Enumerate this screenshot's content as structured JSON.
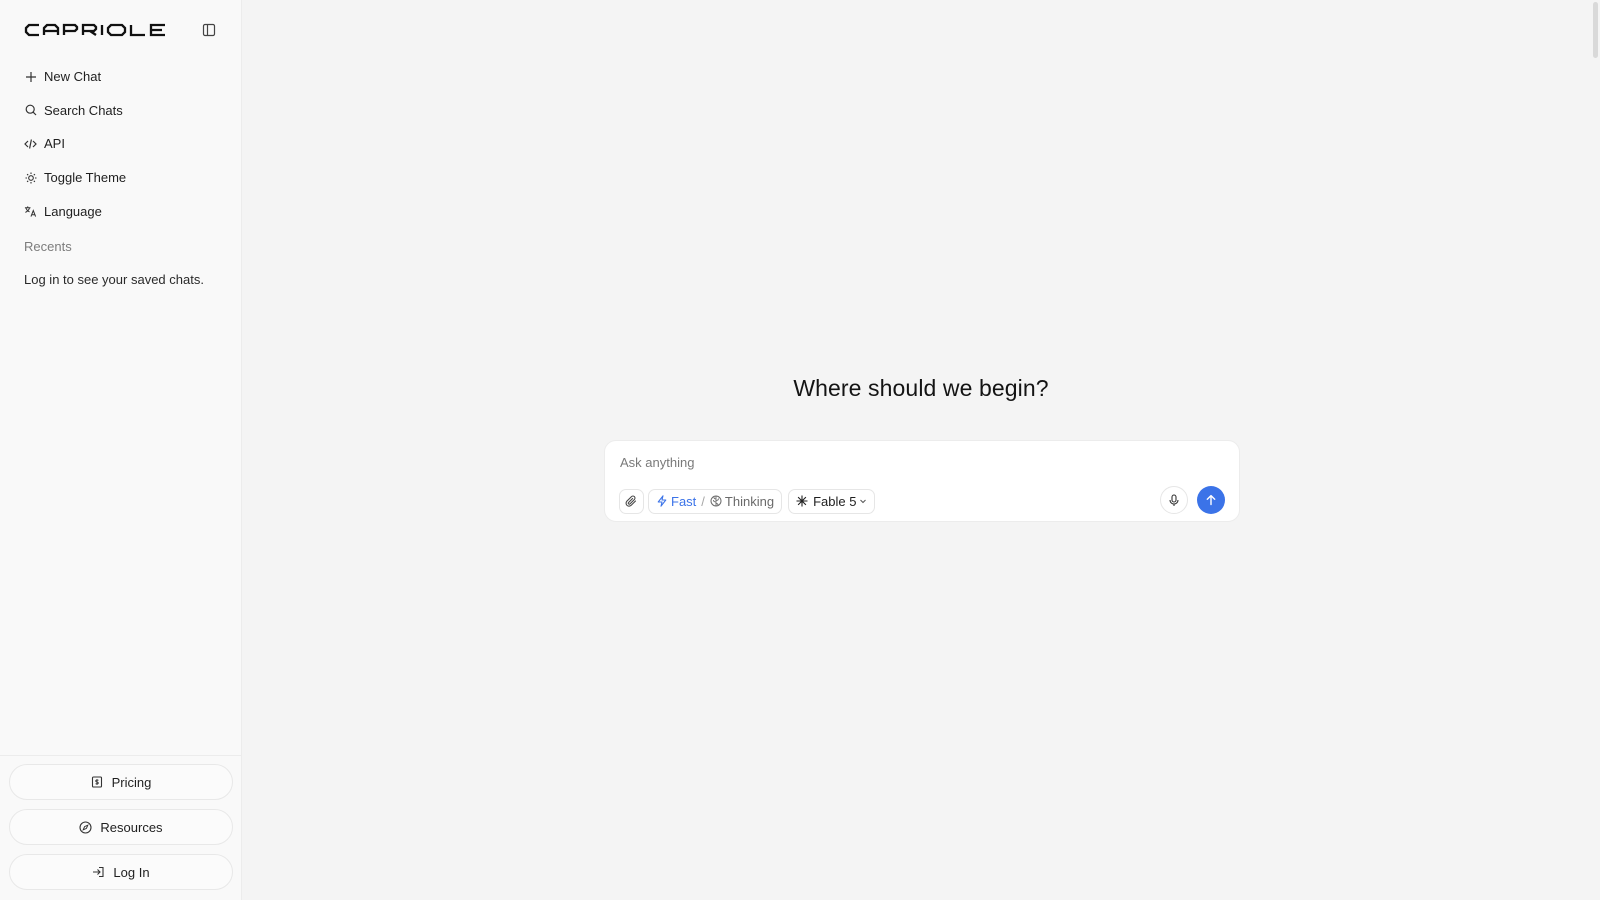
{
  "brand": {
    "logo_text": "CAPRIOLE",
    "collapse_icon": "sidebar-panel-icon"
  },
  "sidebar": {
    "items": [
      {
        "label": "New Chat",
        "icon": "plus-icon"
      },
      {
        "label": "Search Chats",
        "icon": "search-icon"
      },
      {
        "label": "API",
        "icon": "code-icon"
      },
      {
        "label": "Toggle Theme",
        "icon": "sun-icon"
      },
      {
        "label": "Language",
        "icon": "translate-icon"
      }
    ],
    "recents_title": "Recents",
    "recents_empty": "Log in to see your saved chats.",
    "bottom_buttons": [
      {
        "label": "Pricing",
        "icon": "receipt-icon"
      },
      {
        "label": "Resources",
        "icon": "compass-icon"
      },
      {
        "label": "Log In",
        "icon": "login-icon"
      }
    ]
  },
  "main": {
    "heading": "Where should we begin?",
    "composer": {
      "placeholder": "Ask anything",
      "value": "",
      "modes": [
        {
          "label": "Fast",
          "icon": "lightning-icon",
          "active": true
        },
        {
          "label": "Thinking",
          "icon": "brain-icon",
          "active": false
        }
      ],
      "mode_separator": "/",
      "model_label": "Fable 5",
      "model_icon": "sparkle-icon"
    }
  },
  "colors": {
    "accent": "#3b73e8",
    "sidebar_bg": "#f9f9f9",
    "main_bg": "#f4f4f4"
  }
}
